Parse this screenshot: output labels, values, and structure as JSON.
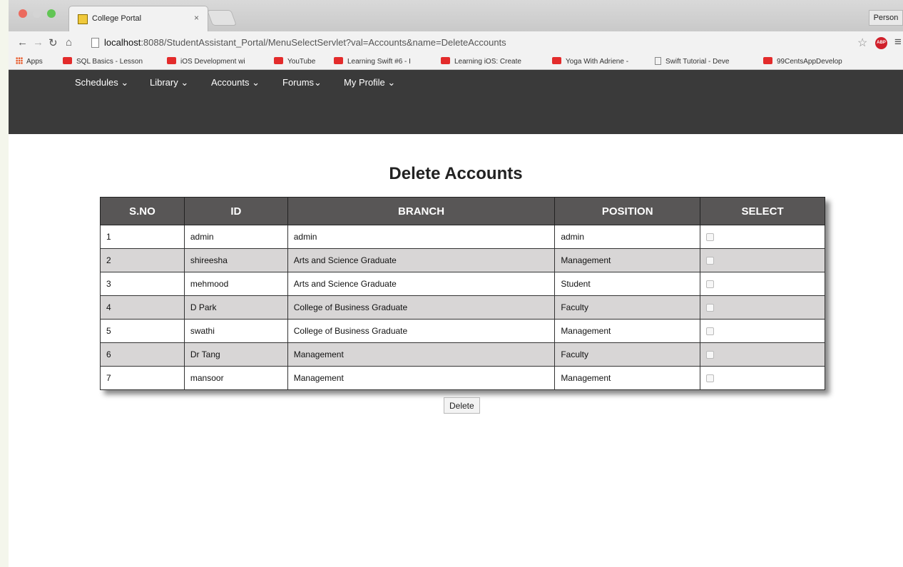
{
  "browser": {
    "tab_title": "College Portal",
    "tab_close": "×",
    "person_label": "Person",
    "url_host": "localhost",
    "url_rest": ":8088/StudentAssistant_Portal/MenuSelectServlet?val=Accounts&name=DeleteAccounts",
    "abp_label": "ABP",
    "bookmarks": [
      "Apps",
      "SQL Basics - Lesson",
      "iOS Development wi",
      "YouTube",
      "Learning Swift #6 - I",
      "Learning iOS: Create",
      "Yoga With Adriene -",
      "Swift Tutorial - Deve",
      "99CentsAppDevelop"
    ]
  },
  "nav": {
    "items": [
      "Schedules ⌄",
      "Library ⌄",
      "Accounts ⌄",
      "Forums⌄",
      "My Profile ⌄"
    ]
  },
  "page": {
    "title": "Delete Accounts",
    "delete_label": "Delete"
  },
  "table": {
    "headers": [
      "S.NO",
      "ID",
      "BRANCH",
      "POSITION",
      "SELECT"
    ],
    "rows": [
      {
        "sno": "1",
        "id": "admin",
        "branch": "admin",
        "position": "admin"
      },
      {
        "sno": "2",
        "id": "shireesha",
        "branch": "Arts and Science Graduate",
        "position": "Management"
      },
      {
        "sno": "3",
        "id": "mehmood",
        "branch": "Arts and Science Graduate",
        "position": "Student"
      },
      {
        "sno": "4",
        "id": "D Park",
        "branch": "College of Business Graduate",
        "position": "Faculty"
      },
      {
        "sno": "5",
        "id": "swathi",
        "branch": "College of Business Graduate",
        "position": "Management"
      },
      {
        "sno": "6",
        "id": "Dr Tang",
        "branch": "Management",
        "position": "Faculty"
      },
      {
        "sno": "7",
        "id": "mansoor",
        "branch": "Management",
        "position": "Management"
      }
    ]
  }
}
